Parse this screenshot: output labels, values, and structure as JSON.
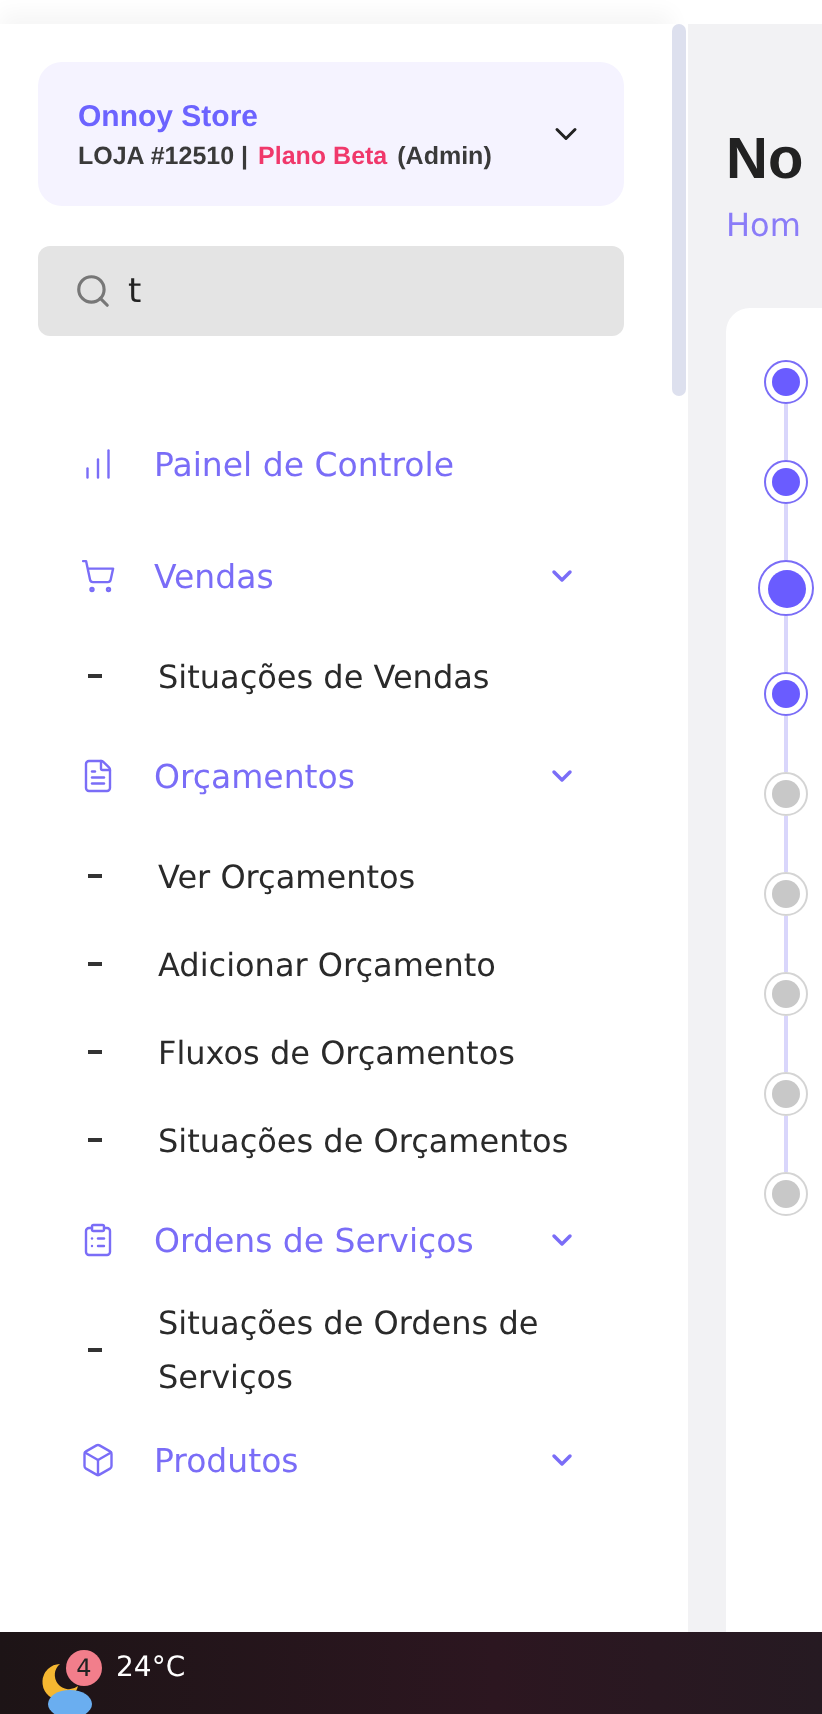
{
  "store": {
    "name": "Onnoy Store",
    "code": "LOJA #12510 |",
    "plan": "Plano Beta",
    "role": "(Admin)"
  },
  "search": {
    "value": "t"
  },
  "menu": [
    {
      "label": "Painel de Controle",
      "chevron": false
    },
    {
      "label": "Vendas",
      "chevron": true,
      "children": [
        {
          "label": "Situações de Vendas"
        }
      ]
    },
    {
      "label": "Orçamentos",
      "chevron": true,
      "children": [
        {
          "label": "Ver Orçamentos"
        },
        {
          "label": "Adicionar Orçamento"
        },
        {
          "label": "Fluxos de Orçamentos"
        },
        {
          "label": "Situações de Orçamentos"
        }
      ]
    },
    {
      "label": "Ordens de Serviços",
      "chevron": true,
      "children": [
        {
          "label": "Situações de Ordens de Serviços"
        }
      ]
    },
    {
      "label": "Produtos",
      "chevron": true
    }
  ],
  "main": {
    "title": "No",
    "breadcrumb": "Hom"
  },
  "steps": [
    {
      "kind": "done"
    },
    {
      "kind": "done"
    },
    {
      "kind": "current"
    },
    {
      "kind": "done"
    },
    {
      "kind": "pending"
    },
    {
      "kind": "pending"
    },
    {
      "kind": "pending"
    },
    {
      "kind": "pending"
    },
    {
      "kind": "pending"
    }
  ],
  "taskbar": {
    "badge": "4",
    "temperature": "24°C"
  }
}
